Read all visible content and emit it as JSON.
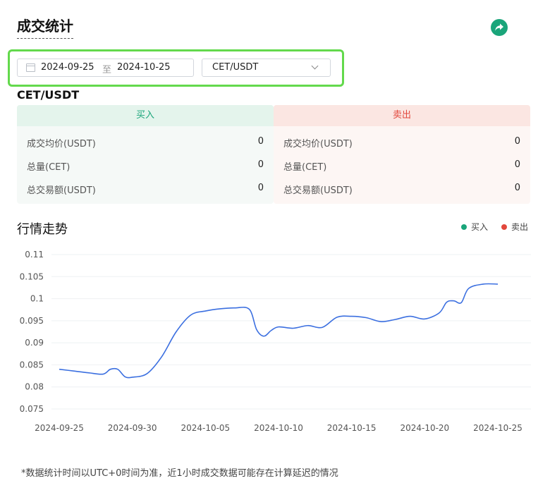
{
  "page": {
    "title": "成交统计",
    "share_icon": "share-arrow-icon",
    "note": "*数据统计时间以UTC+0时间为准，近1小时成交数据可能存在计算延迟的情况"
  },
  "filters": {
    "calendar_icon": "calendar-icon",
    "start_date": "2024-09-25",
    "separator": "至",
    "end_date": "2024-10-25",
    "pair": "CET/USDT"
  },
  "pair_heading": "CET/USDT",
  "buy": {
    "label": "买入",
    "color": "#1aa57a",
    "rows": [
      {
        "label": "成交均价(USDT)",
        "value": "0"
      },
      {
        "label": "总量(CET)",
        "value": "0"
      },
      {
        "label": "总交易额(USDT)",
        "value": "0"
      }
    ]
  },
  "sell": {
    "label": "卖出",
    "color": "#e2473c",
    "rows": [
      {
        "label": "成交均价(USDT)",
        "value": "0"
      },
      {
        "label": "总量(CET)",
        "value": "0"
      },
      {
        "label": "总交易额(USDT)",
        "value": "0"
      }
    ]
  },
  "trend": {
    "title": "行情走势",
    "legend": [
      {
        "name": "买入",
        "color": "#1aa57a"
      },
      {
        "name": "卖出",
        "color": "#e2473c"
      }
    ]
  },
  "chart_data": {
    "type": "line",
    "title": "",
    "xlabel": "",
    "ylabel": "",
    "line_color": "#3b6fe0",
    "grid": true,
    "ylim": [
      0.075,
      0.11
    ],
    "yticks": [
      "0.11",
      "0.105",
      "0.1",
      "0.095",
      "0.09",
      "0.085",
      "0.08",
      "0.075"
    ],
    "xticks": [
      "2024-09-25",
      "2024-09-30",
      "2024-10-05",
      "2024-10-10",
      "2024-10-15",
      "2024-10-20",
      "2024-10-25"
    ],
    "x": [
      "2024-09-25",
      "2024-09-26",
      "2024-09-27",
      "2024-09-28",
      "2024-09-28T12",
      "2024-09-29",
      "2024-09-29T12",
      "2024-09-30",
      "2024-10-01",
      "2024-10-02",
      "2024-10-03",
      "2024-10-04",
      "2024-10-05",
      "2024-10-06",
      "2024-10-07",
      "2024-10-08",
      "2024-10-08T12",
      "2024-10-09",
      "2024-10-09T12",
      "2024-10-10",
      "2024-10-11",
      "2024-10-12",
      "2024-10-13",
      "2024-10-14",
      "2024-10-15",
      "2024-10-16",
      "2024-10-17",
      "2024-10-18",
      "2024-10-19",
      "2024-10-20",
      "2024-10-21",
      "2024-10-21T12",
      "2024-10-22",
      "2024-10-22T12",
      "2024-10-23",
      "2024-10-24",
      "2024-10-25"
    ],
    "values": [
      0.084,
      0.0836,
      0.0832,
      0.0829,
      0.084,
      0.084,
      0.0823,
      0.0822,
      0.083,
      0.0868,
      0.0925,
      0.0963,
      0.0972,
      0.0977,
      0.0979,
      0.0976,
      0.093,
      0.0915,
      0.0928,
      0.0936,
      0.0933,
      0.0939,
      0.0935,
      0.0958,
      0.096,
      0.0957,
      0.0948,
      0.0953,
      0.096,
      0.0954,
      0.0968,
      0.0992,
      0.0995,
      0.0991,
      0.1023,
      0.1033,
      0.1033
    ]
  }
}
